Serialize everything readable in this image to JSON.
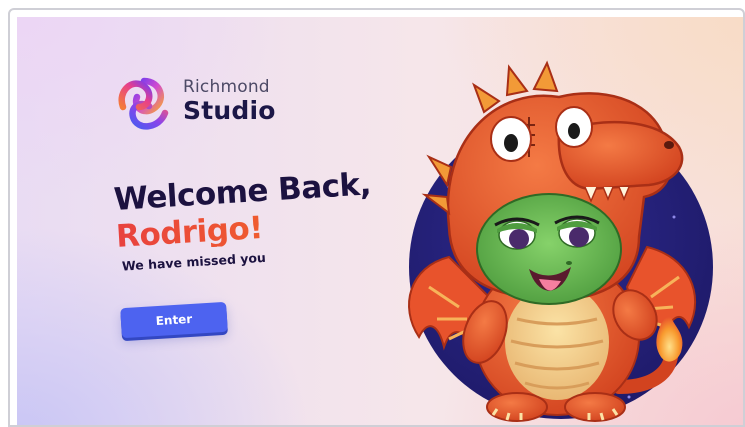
{
  "brand": {
    "line1": "Richmond",
    "line2": "Studio"
  },
  "welcome": {
    "headline": "Welcome Back,",
    "name": "Rodrigo!",
    "subline": "We have missed you"
  },
  "actions": {
    "enter_label": "Enter"
  },
  "icons": {
    "logo": "richmond-knot-logo-icon",
    "mascot": "dragon-mascot-illustration"
  },
  "colors": {
    "heading": "#1c1240",
    "name_gradient_start": "#e8423f",
    "name_gradient_end": "#f7931e",
    "button": "#4d63f0",
    "circle": "#25217a",
    "dragon_orange": "#e8532c",
    "dragon_green": "#6cbf55"
  }
}
